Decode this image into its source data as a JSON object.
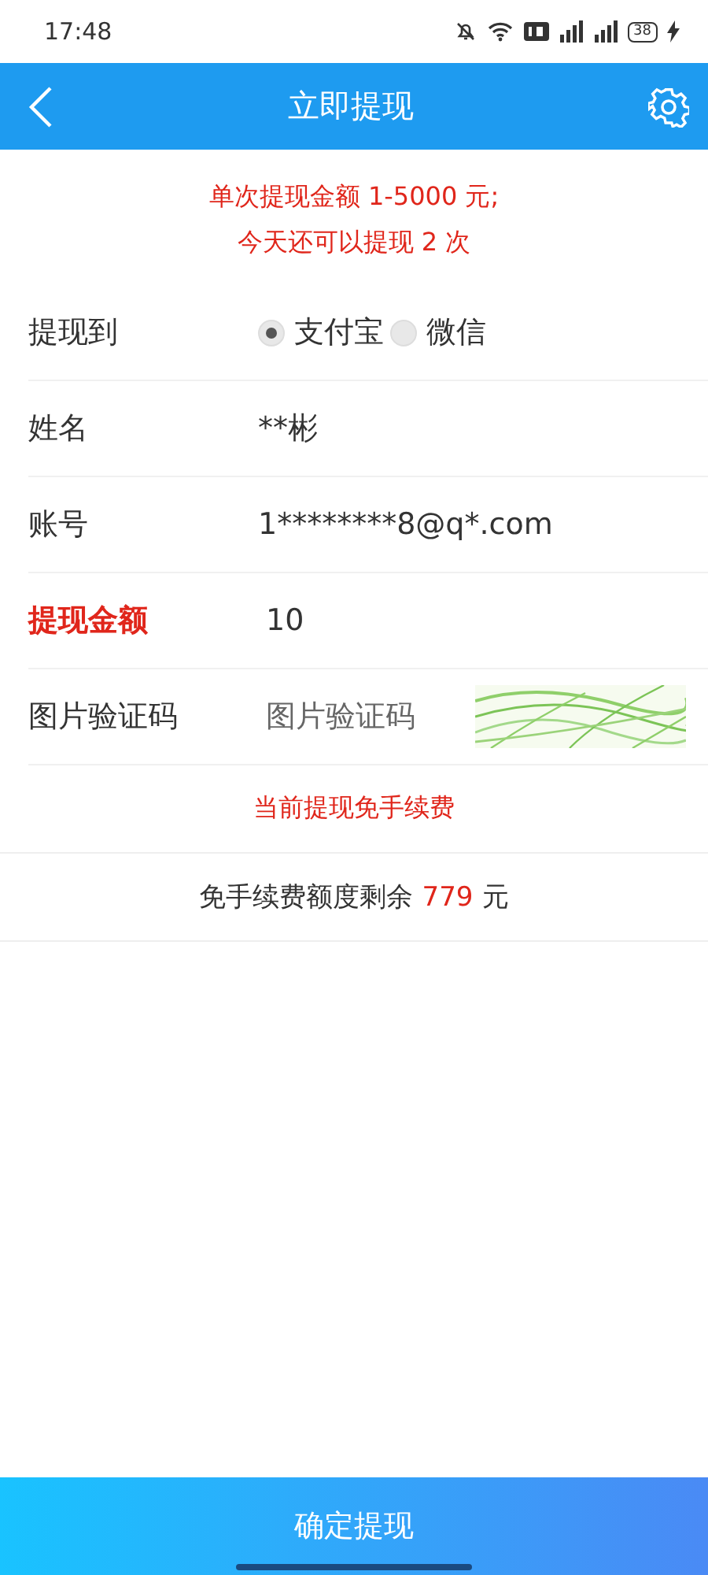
{
  "status_bar": {
    "time": "17:48",
    "battery": "38"
  },
  "header": {
    "title": "立即提现"
  },
  "notices": [
    "单次提现金额 1-5000 元;",
    "今天还可以提现 2 次"
  ],
  "form": [
    {
      "kind": "radio",
      "label": "提现到",
      "highlighted": false,
      "options": [
        {
          "label": "支付宝",
          "selected": true
        },
        {
          "label": "微信",
          "selected": false
        }
      ]
    },
    {
      "kind": "text",
      "label": "姓名",
      "highlighted": false,
      "value": "**彬"
    },
    {
      "kind": "text",
      "label": "账号",
      "highlighted": false,
      "value": "1********8@q*.com"
    },
    {
      "kind": "input",
      "label": "提现金额",
      "highlighted": true,
      "value": "10"
    },
    {
      "kind": "captcha",
      "label": "图片验证码",
      "highlighted": false,
      "placeholder": "图片验证码"
    }
  ],
  "fee_notice": "当前提现免手续费",
  "quota": {
    "before": "免手续费额度剩余",
    "amount": "779",
    "after": "元"
  },
  "submit_button": "确定提现"
}
